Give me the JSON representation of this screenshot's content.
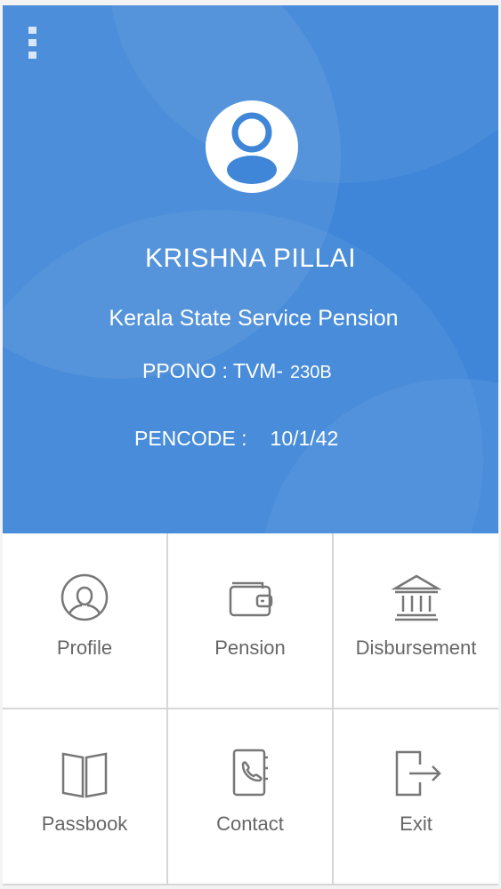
{
  "colors": {
    "header_bg": "#3f86d8",
    "tile_bg": "#ffffff",
    "tile_text": "#666666",
    "icon_stroke": "#777777"
  },
  "header": {
    "menu_icon": "overflow-menu-icon",
    "avatar_icon": "user-avatar-icon",
    "name": "KRISHNA PILLAI",
    "scheme": "Kerala State Service Pension",
    "ppono_label": "PPONO : TVM-",
    "ppono_value": "230B",
    "pencode_label": "PENCODE :",
    "pencode_value": "10/1/42"
  },
  "tiles": [
    {
      "label": "Profile",
      "icon": "profile-icon"
    },
    {
      "label": "Pension",
      "icon": "wallet-icon"
    },
    {
      "label": "Disbursement",
      "icon": "bank-icon"
    },
    {
      "label": "Passbook",
      "icon": "book-icon"
    },
    {
      "label": "Contact",
      "icon": "phonebook-icon"
    },
    {
      "label": "Exit",
      "icon": "exit-icon"
    }
  ]
}
